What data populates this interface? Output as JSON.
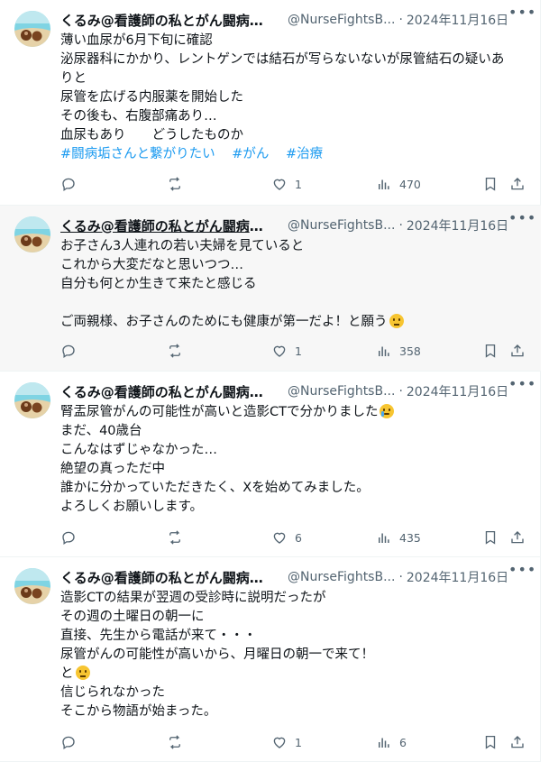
{
  "posts": [
    {
      "author_name": "くるみ@看護師の私とがん闘病の...",
      "handle": "@NurseFightsB...",
      "date": "2024年11月16日",
      "lines": [
        "薄い血尿が6月下旬に確認",
        "泌尿器科にかかり、レントゲンでは結石が写らないないが尿管結石の疑いあ",
        "りと",
        "尿管を広げる内服薬を開始した",
        "その後も、右腹部痛あり…",
        "血尿もあり　　どうしたものか"
      ],
      "hashtags": [
        "#闘病垢さんと繋がりたい",
        "#がん",
        "#治療"
      ],
      "likes": "1",
      "views": "470"
    },
    {
      "author_name": "くるみ@看護師の私とがん闘病の...",
      "handle": "@NurseFightsB...",
      "date": "2024年11月16日",
      "lines": [
        "お子さん3人連れの若い夫婦を見ていると",
        "これから大変だなと思いつつ…",
        "自分も何とか生きて来たと感じる",
        "",
        "ご両親様、お子さんのためにも健康が第一だよ！と願う"
      ],
      "likes": "1",
      "views": "358"
    },
    {
      "author_name": "くるみ@看護師の私とがん闘病の...",
      "handle": "@NurseFightsB...",
      "date": "2024年11月16日",
      "lines": [
        "腎盂尿管がんの可能性が高いと造影CTで分かりました",
        "まだ、40歳台",
        "こんなはずじゃなかった…",
        "絶望の真っただ中",
        "誰かに分かっていただきたく、Xを始めてみました。",
        "よろしくお願いします。"
      ],
      "likes": "6",
      "views": "435"
    },
    {
      "author_name": "くるみ@看護師の私とがん闘病の...",
      "handle": "@NurseFightsB...",
      "date": "2024年11月16日",
      "lines": [
        "造影CTの結果が翌週の受診時に説明だったが",
        "その週の土曜日の朝一に",
        "直接、先生から電話が来て・・・",
        "尿管がんの可能性が高いから、月曜日の朝一で来て！",
        "と",
        "信じられなかった",
        "そこから物語が始まった。"
      ],
      "likes": "1",
      "views": "6"
    }
  ],
  "icons": {
    "reply": "reply-icon",
    "repost": "repost-icon",
    "like": "heart-icon",
    "views": "views-icon",
    "bookmark": "bookmark-icon",
    "share": "share-icon",
    "more": "more-icon"
  },
  "colors": {
    "link": "#1d9bf0",
    "secondary": "#536471",
    "text": "#0f1419"
  }
}
